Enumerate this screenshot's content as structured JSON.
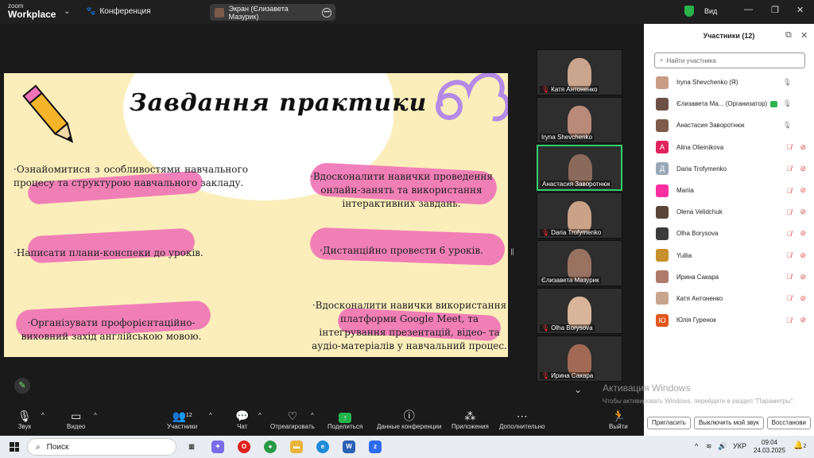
{
  "app": {
    "logo_small": "zoom",
    "logo_big": "Workplace",
    "conference_label": "Конференция",
    "screen_share_label": "Экран (Єлизавета Мазурик)",
    "view_label": "Вид"
  },
  "slide": {
    "title": "Завдання практики",
    "items": [
      "·Ознайомитися з особливостями навчального процесу та структурою навчального закладу.",
      "·Вдосконалити навички проведення онлайн-занять та використання інтерактивних завдань.",
      "·Написати плани-конспеки до уроків.",
      "·Дистанційно провести 6 уроків.",
      "·Організувати профорієнтаційно-виховний захід англійською мовою.",
      "·Вдосконалити навички використання платформи Google Meet, та інтегрування презентацій, відео- та аудіо-матеріалів у навчальний процес."
    ]
  },
  "thumbnails": [
    {
      "name": "Катя Антоненко",
      "muted": true,
      "active": false,
      "color": "#c9a58d"
    },
    {
      "name": "Iryna Shevchenko",
      "muted": false,
      "active": false,
      "color": "#b98a7a"
    },
    {
      "name": "Анастасия Заворотнюк",
      "muted": false,
      "active": true,
      "color": "#8a6a5a"
    },
    {
      "name": "Daria Trofymenko",
      "muted": true,
      "active": false,
      "color": "#caa288"
    },
    {
      "name": "Єлизавета Мазурик",
      "muted": false,
      "active": false,
      "color": "#9a7262"
    },
    {
      "name": "Olha Borysova",
      "muted": true,
      "active": false,
      "color": "#d8b59a"
    },
    {
      "name": "Ирина Сакара",
      "muted": true,
      "active": false,
      "color": "#a06a55"
    }
  ],
  "participants": {
    "title": "Участники (12)",
    "search_placeholder": "Найти участника",
    "list": [
      {
        "name": "Iryna Shevchenko (Я)",
        "avatar": "",
        "avatar_color": "#c99c86",
        "mic_off": false,
        "cam_off": false
      },
      {
        "name": "Єлизавета Ма... (Организатор)",
        "avatar": "",
        "avatar_color": "#6d5045",
        "mic_off": false,
        "cam_off": false,
        "host": true
      },
      {
        "name": "Анастасия Заворотнюк",
        "avatar": "",
        "avatar_color": "#7d5a4a",
        "mic_off": false,
        "cam_off": false
      },
      {
        "name": "Alina Olieinikova",
        "avatar": "A",
        "avatar_color": "#e0245e",
        "mic_off": true,
        "cam_off": true
      },
      {
        "name": "Daria Trofymenko",
        "avatar": "Д",
        "avatar_color": "#9aa7b8",
        "mic_off": true,
        "cam_off": true
      },
      {
        "name": "Mariia",
        "avatar": "",
        "avatar_color": "#ff2fa0",
        "mic_off": true,
        "cam_off": true
      },
      {
        "name": "Olena Velidchuk",
        "avatar": "",
        "avatar_color": "#5a4538",
        "mic_off": true,
        "cam_off": true
      },
      {
        "name": "Olha Borysova",
        "avatar": "",
        "avatar_color": "#3b3b3b",
        "mic_off": true,
        "cam_off": true
      },
      {
        "name": "Yuliia",
        "avatar": "",
        "avatar_color": "#c8902a",
        "mic_off": true,
        "cam_off": true
      },
      {
        "name": "Ирина Сакара",
        "avatar": "",
        "avatar_color": "#b07a6a",
        "mic_off": true,
        "cam_off": true
      },
      {
        "name": "Катя Антоненко",
        "avatar": "",
        "avatar_color": "#c9a58d",
        "mic_off": true,
        "cam_off": true
      },
      {
        "name": "Юлія Гуренок",
        "avatar": "Ю",
        "avatar_color": "#e3561c",
        "mic_off": true,
        "cam_off": true
      }
    ],
    "buttons": {
      "invite": "Пригласить",
      "mute_me": "Выключить мой звук",
      "restore": "Восстанови"
    }
  },
  "watermark": {
    "line1": "Активация Windows",
    "line2": "Чтобы активировать Windows, перейдите в раздел \"Параметры\"."
  },
  "toolbar": {
    "audio": "Звук",
    "video": "Видео",
    "participants": "Участники",
    "participants_count": "12",
    "chat": "Чат",
    "react": "Отреагировать",
    "share": "Поделиться",
    "info": "Данные конференции",
    "apps": "Приложения",
    "more": "Дополнительно",
    "exit": "Выйти"
  },
  "taskbar": {
    "search": "Поиск",
    "lang": "УКР",
    "time": "09:04",
    "date": "24.03.2025",
    "notif_count": "2"
  }
}
